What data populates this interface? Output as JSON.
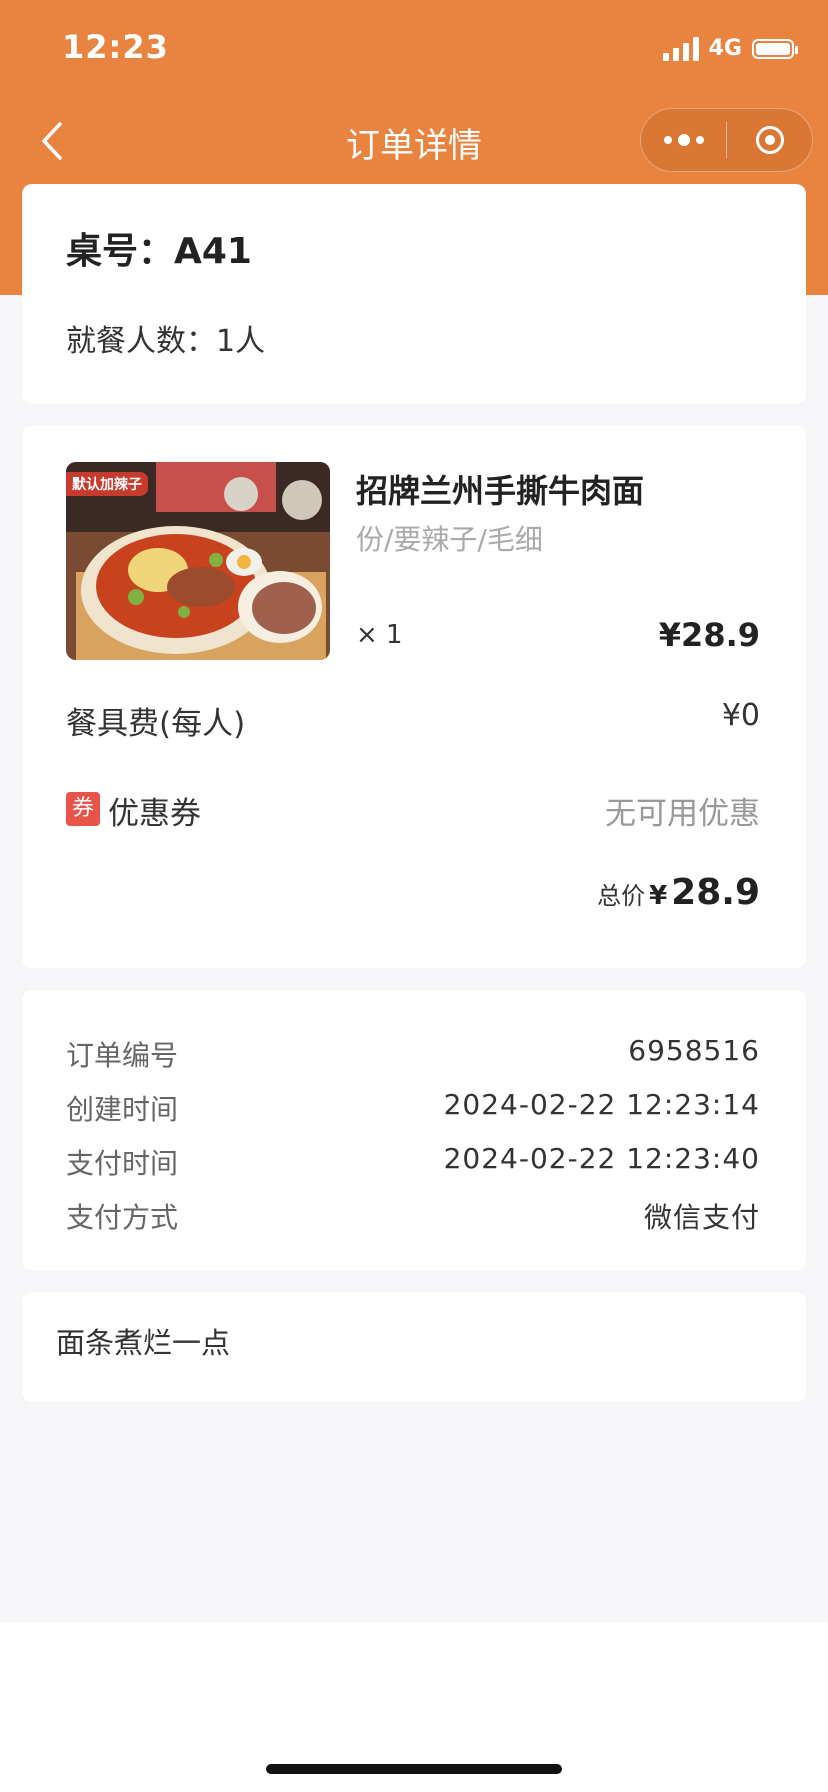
{
  "status_bar": {
    "time": "12:23",
    "network": "4G"
  },
  "nav": {
    "title": "订单详情"
  },
  "table_info": {
    "table_no": "桌号：A41",
    "diners": "就餐人数：1人"
  },
  "order_item": {
    "image_badge": "默认加辣子",
    "name": "招牌兰州手撕牛肉面",
    "spec": "份/要辣子/毛细",
    "quantity": "× 1",
    "price": "¥28.9"
  },
  "fees": {
    "tableware_label": "餐具费(每人)",
    "tableware_value": "¥0",
    "coupon_tag": "券",
    "coupon_label": "优惠券",
    "coupon_value": "无可用优惠",
    "total_label": "总价",
    "total_currency": "¥",
    "total_value": "28.9"
  },
  "order_info": {
    "rows": [
      {
        "label": "订单编号",
        "value": "6958516"
      },
      {
        "label": "创建时间",
        "value": "2024-02-22 12:23:14"
      },
      {
        "label": "支付时间",
        "value": "2024-02-22 12:23:40"
      },
      {
        "label": "支付方式",
        "value": "微信支付"
      }
    ]
  },
  "remark": "面条煮烂一点",
  "colors": {
    "brand": "#e8843f",
    "coupon": "#e8534a"
  },
  "icons": [
    "back-arrow-icon",
    "more-dots-icon",
    "target-icon",
    "signal-icon",
    "battery-icon"
  ]
}
